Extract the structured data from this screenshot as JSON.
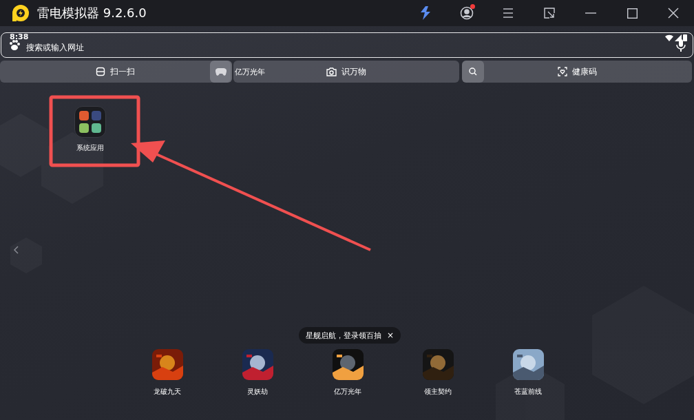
{
  "window": {
    "title": "雷电模拟器 9.2.6.0",
    "notification_dot": true
  },
  "status_bar": {
    "time": "8:38"
  },
  "search": {
    "placeholder": "搜索或输入网址"
  },
  "shortcuts": [
    {
      "label": "扫一扫",
      "kind": "scan"
    },
    {
      "label": "识万物",
      "kind": "camera"
    },
    {
      "label": "健康码",
      "kind": "health"
    }
  ],
  "game_chip": {
    "label": "亿万光年"
  },
  "desktop": [
    {
      "label": "系统应用",
      "kind": "folder"
    }
  ],
  "tooltip": {
    "text": "星舰启航，登录领百抽",
    "close": "×"
  },
  "dock": [
    {
      "label": "龙破九天",
      "kind": "picture"
    },
    {
      "label": "灵妖劫",
      "kind": "picture"
    },
    {
      "label": "亿万光年",
      "kind": "picture"
    },
    {
      "label": "领主契约",
      "kind": "picture"
    },
    {
      "label": "苍蓝前线",
      "kind": "picture"
    }
  ]
}
